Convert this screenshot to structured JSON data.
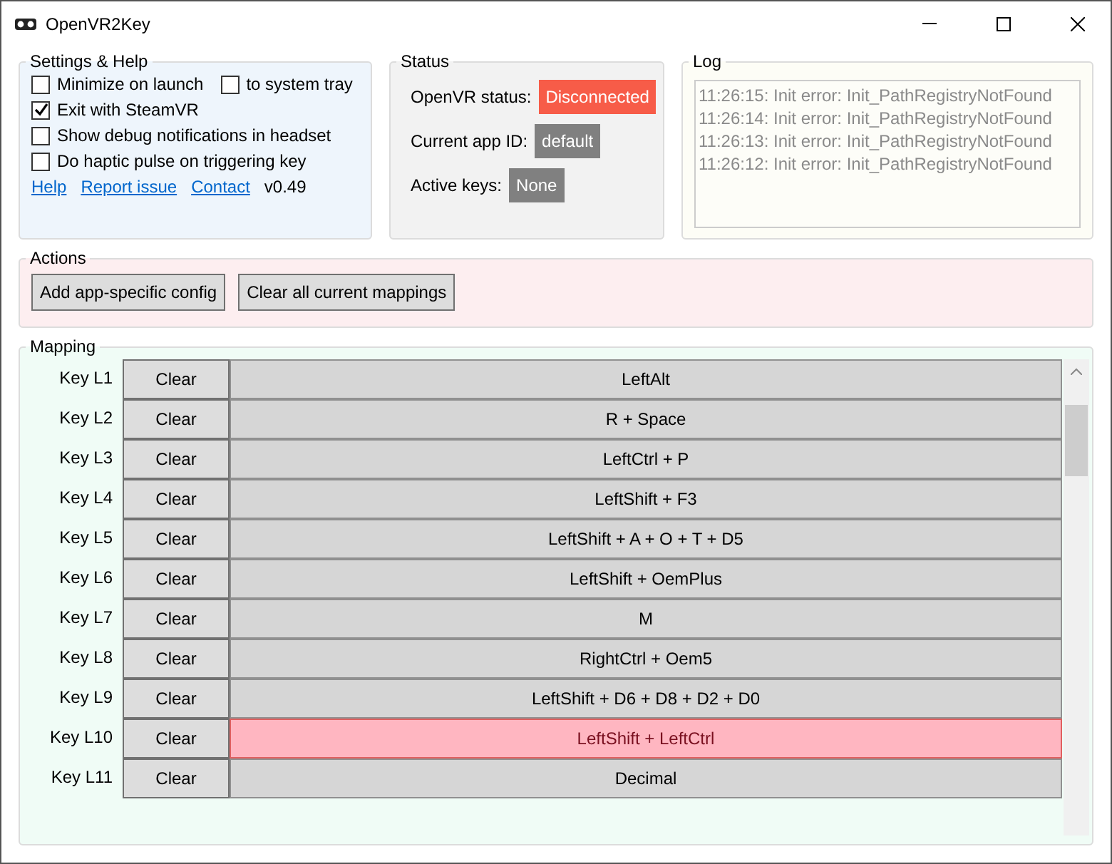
{
  "window": {
    "title": "OpenVR2Key"
  },
  "settings": {
    "title": "Settings & Help",
    "options": [
      {
        "label": "Minimize on launch",
        "checked": false
      },
      {
        "label": "to system tray",
        "checked": false
      },
      {
        "label": "Exit with SteamVR",
        "checked": true
      },
      {
        "label": "Show debug notifications in headset",
        "checked": false
      },
      {
        "label": "Do haptic pulse on triggering key",
        "checked": false
      }
    ],
    "links": [
      "Help",
      "Report issue",
      "Contact"
    ],
    "version": "v0.49"
  },
  "status": {
    "title": "Status",
    "items": [
      {
        "label": "OpenVR status:",
        "value": "Disconnected",
        "color": "#f75c48"
      },
      {
        "label": "Current app ID:",
        "value": "default",
        "color": "#808080"
      },
      {
        "label": "Active keys:",
        "value": "None",
        "color": "#808080"
      }
    ]
  },
  "log": {
    "title": "Log",
    "lines": [
      "11:26:15: Init error: Init_PathRegistryNotFound",
      "11:26:14: Init error: Init_PathRegistryNotFound",
      "11:26:13: Init error: Init_PathRegistryNotFound",
      "11:26:12: Init error: Init_PathRegistryNotFound"
    ]
  },
  "actions": {
    "title": "Actions",
    "buttons": [
      "Add app-specific config",
      "Clear all current mappings"
    ]
  },
  "mapping": {
    "title": "Mapping",
    "rows": [
      {
        "key": "Key L1",
        "clear": "Clear",
        "binding": "LeftAlt",
        "selected": false
      },
      {
        "key": "Key L2",
        "clear": "Clear",
        "binding": "R + Space",
        "selected": false
      },
      {
        "key": "Key L3",
        "clear": "Clear",
        "binding": "LeftCtrl + P",
        "selected": false
      },
      {
        "key": "Key L4",
        "clear": "Clear",
        "binding": "LeftShift + F3",
        "selected": false
      },
      {
        "key": "Key L5",
        "clear": "Clear",
        "binding": "LeftShift + A + O + T + D5",
        "selected": false
      },
      {
        "key": "Key L6",
        "clear": "Clear",
        "binding": "LeftShift + OemPlus",
        "selected": false
      },
      {
        "key": "Key L7",
        "clear": "Clear",
        "binding": "M",
        "selected": false
      },
      {
        "key": "Key L8",
        "clear": "Clear",
        "binding": "RightCtrl + Oem5",
        "selected": false
      },
      {
        "key": "Key L9",
        "clear": "Clear",
        "binding": "LeftShift + D6 + D8 + D2 + D0",
        "selected": false
      },
      {
        "key": "Key L10",
        "clear": "Clear",
        "binding": "LeftShift + LeftCtrl",
        "selected": true
      },
      {
        "key": "Key L11",
        "clear": "Clear",
        "binding": "Decimal",
        "selected": false
      }
    ]
  }
}
